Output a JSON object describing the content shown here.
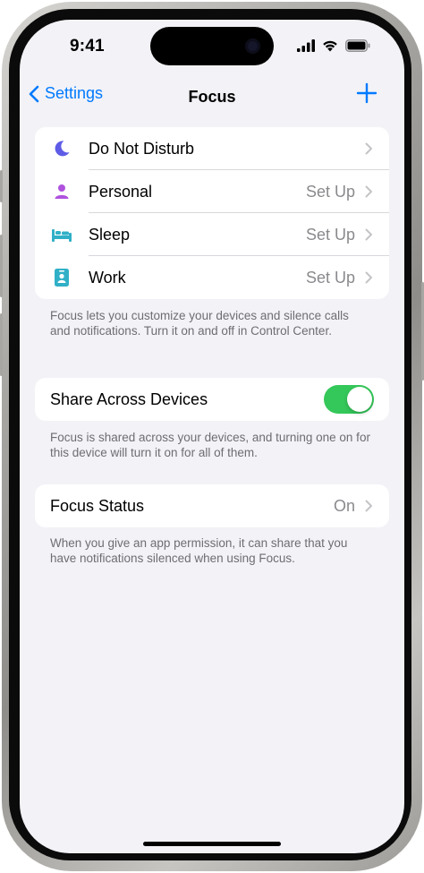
{
  "status_bar": {
    "time": "9:41"
  },
  "nav": {
    "back_label": "Settings",
    "title": "Focus",
    "add_icon": "plus-icon"
  },
  "focus_modes": [
    {
      "label": "Do Not Disturb",
      "value": "",
      "icon": "moon-icon",
      "color": "#5e5ce6"
    },
    {
      "label": "Personal",
      "value": "Set Up",
      "icon": "person-icon",
      "color": "#af52de"
    },
    {
      "label": "Sleep",
      "value": "Set Up",
      "icon": "bed-icon",
      "color": "#30b0c7"
    },
    {
      "label": "Work",
      "value": "Set Up",
      "icon": "id-badge-icon",
      "color": "#30b0c7"
    }
  ],
  "focus_footnote": "Focus lets you customize your devices and silence calls and notifications. Turn it on and off in Control Center.",
  "share": {
    "label": "Share Across Devices",
    "enabled": true,
    "toggle_color": "#34c759"
  },
  "share_footnote": "Focus is shared across your devices, and turning one on for this device will turn it on for all of them.",
  "focus_status": {
    "label": "Focus Status",
    "value": "On"
  },
  "status_footnote": "When you give an app permission, it can share that you have notifications silenced when using Focus.",
  "colors": {
    "accent": "#007aff",
    "background": "#f2f2f7",
    "secondary_text": "#8a8a8e"
  }
}
